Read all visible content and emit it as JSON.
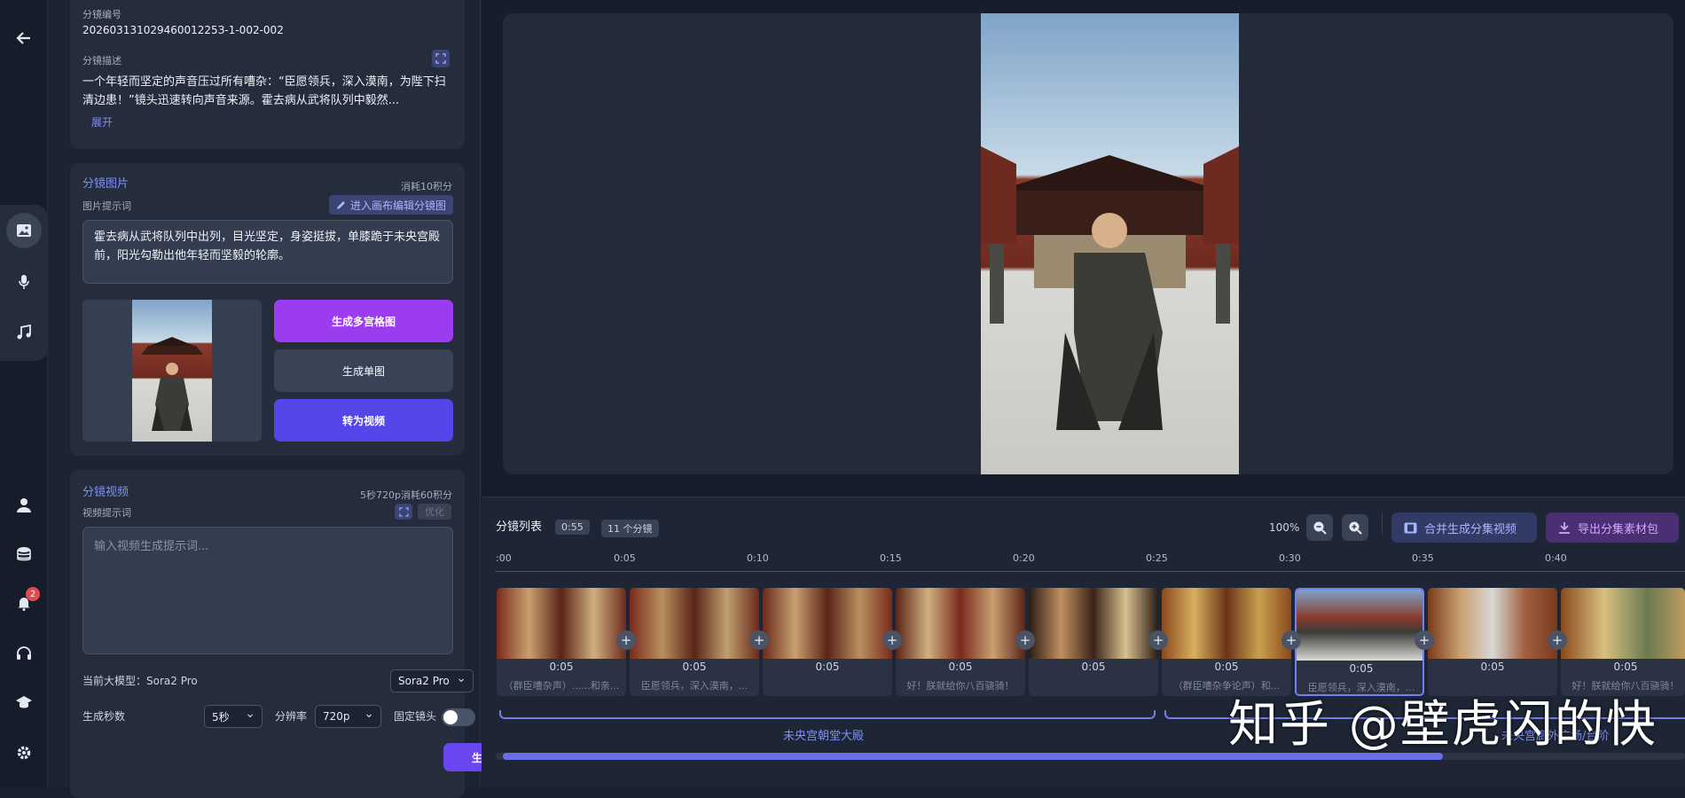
{
  "rail": {
    "notification_count": "2"
  },
  "shot": {
    "id_label": "分镜编号",
    "id_value": "20260313102946001225З-1-002-002",
    "desc_label": "分镜描述",
    "desc_text": "一个年轻而坚定的声音压过所有嘈杂：“臣愿领兵，深入漠南，为陛下扫清边患！”镜头迅速转向声音来源。霍去病从武将队列中毅然...",
    "expand": "展开"
  },
  "image_card": {
    "title": "分镜图片",
    "cost": "消耗10积分",
    "prompt_label": "图片提示词",
    "canvas_button": "进入画布编辑分镜图",
    "prompt_text": "霍去病从武将队列中出列，目光坚定，身姿挺拔，单膝跪于未央宫殿前，阳光勾勒出他年轻而坚毅的轮廓。",
    "btn_grid": "生成多宫格图",
    "btn_single": "生成单图",
    "btn_video": "转为视频"
  },
  "video_card": {
    "title": "分镜视频",
    "cost": "5秒720p消耗60积分",
    "prompt_label": "视频提示词",
    "optimize": "优化",
    "placeholder": "输入视频生成提示词...",
    "model_label": "当前大模型：Sora2 Pro",
    "model_value": "Sora2 Pro",
    "duration_label": "生成秒数",
    "duration_value": "5秒",
    "res_label": "分辨率",
    "res_value": "720p",
    "fixed_label": "固定镜头",
    "generate": "生成"
  },
  "timeline": {
    "title": "分镜列表",
    "total": "0:55",
    "count": "11 个分镜",
    "zoom": "100%",
    "merge_button": "合并生成分集视频",
    "export_button": "导出分集素材包",
    "ticks": [
      ":00",
      "0:05",
      "0:10",
      "0:15",
      "0:20",
      "0:25",
      "0:30",
      "0:35",
      "0:40"
    ],
    "clips": [
      {
        "duration": "0:05",
        "caption": "（群臣嘈杂声）......和亲..."
      },
      {
        "duration": "0:05",
        "caption": "臣愿领兵，深入漠南，..."
      },
      {
        "duration": "0:05",
        "caption": ""
      },
      {
        "duration": "0:05",
        "caption": "好！朕就给你八百骁骑！"
      },
      {
        "duration": "0:05",
        "caption": ""
      },
      {
        "duration": "0:05",
        "caption": "（群臣嘈杂争论声）和..."
      },
      {
        "duration": "0:05",
        "caption": "臣愿领兵，深入漠南，..."
      },
      {
        "duration": "0:05",
        "caption": ""
      },
      {
        "duration": "0:05",
        "caption": "好！朕就给你八百骁骑！"
      }
    ],
    "scene1": "未央宫朝堂大殿",
    "scene2": "未央宫廊外广场/台阶"
  },
  "watermark": "知乎 @壁虎闪的快"
}
